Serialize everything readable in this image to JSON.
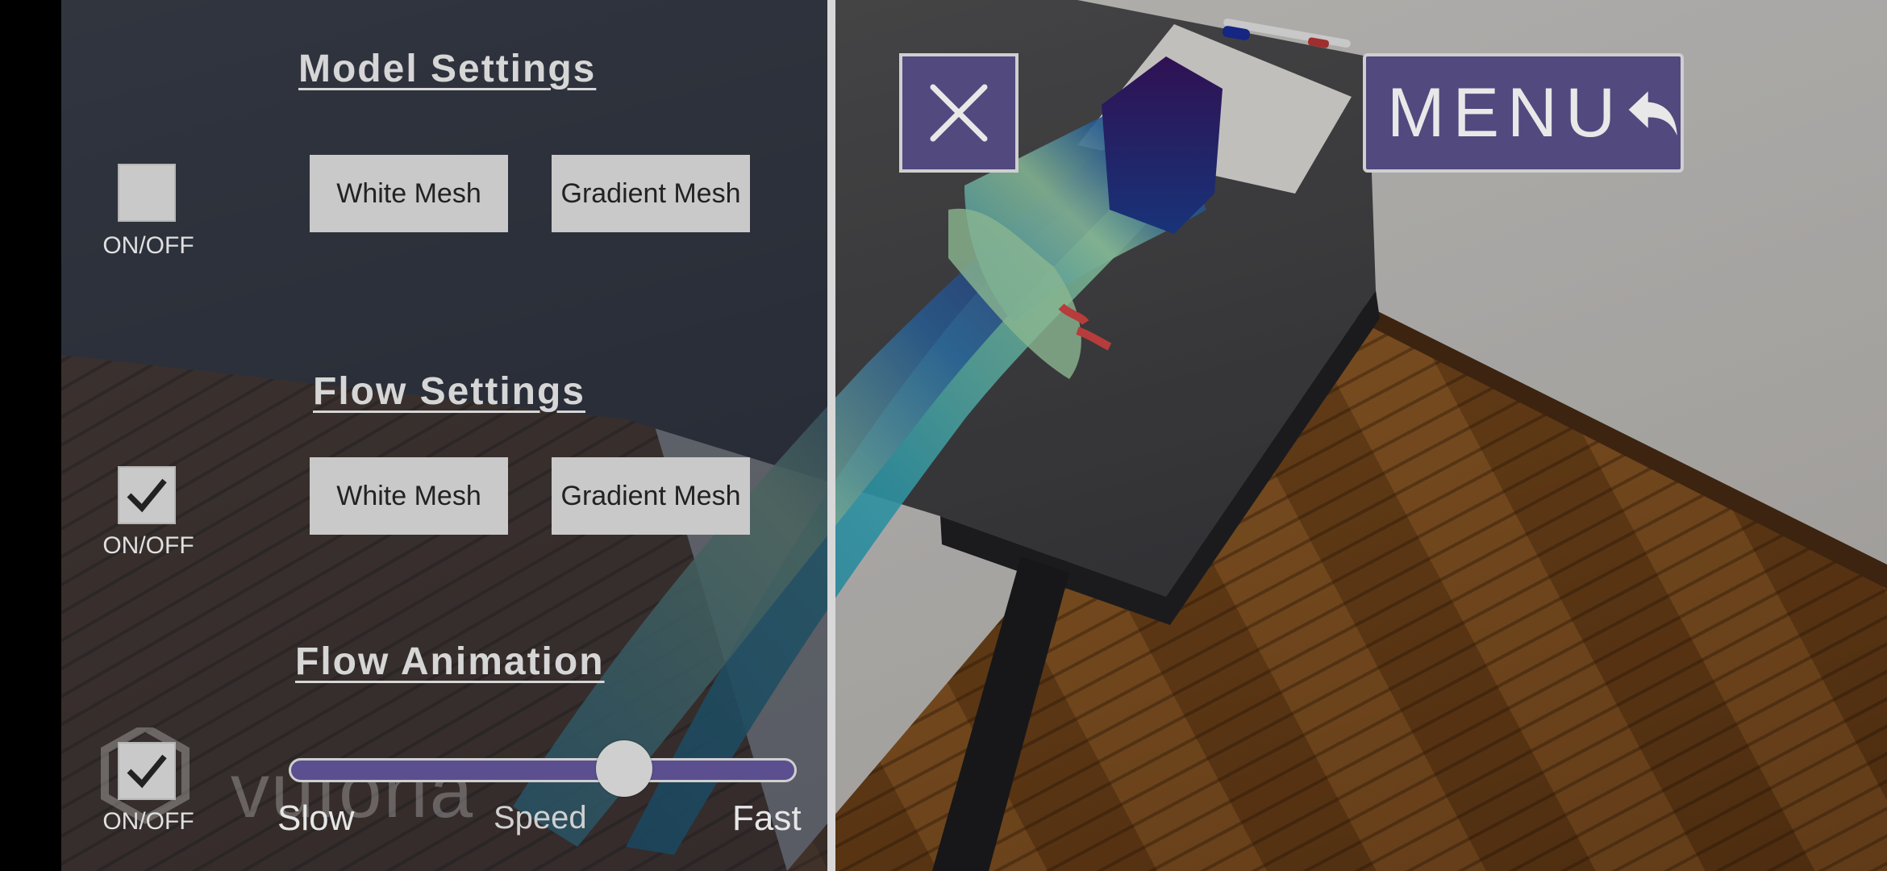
{
  "model_settings": {
    "title": "Model Settings",
    "toggle_checked": false,
    "toggle_label": "ON/OFF",
    "white_mesh_label": "White Mesh",
    "gradient_mesh_label": "Gradient Mesh"
  },
  "flow_settings": {
    "title": "Flow Settings",
    "toggle_checked": true,
    "toggle_label": "ON/OFF",
    "white_mesh_label": "White Mesh",
    "gradient_mesh_label": "Gradient Mesh"
  },
  "flow_animation": {
    "title": "Flow Animation",
    "toggle_checked": true,
    "toggle_label": "ON/OFF",
    "speed_min_label": "Slow",
    "speed_label": "Speed",
    "speed_max_label": "Fast",
    "speed_value_fraction": 0.68
  },
  "watermark": {
    "text": "vuforia"
  },
  "top_controls": {
    "close_icon": "close-icon",
    "menu_label": "MENU",
    "menu_icon": "back-arrow-icon"
  },
  "colors": {
    "accent_purple": "#52497e",
    "button_gray": "#c9c9c9",
    "text_light": "#d6d6d6"
  }
}
